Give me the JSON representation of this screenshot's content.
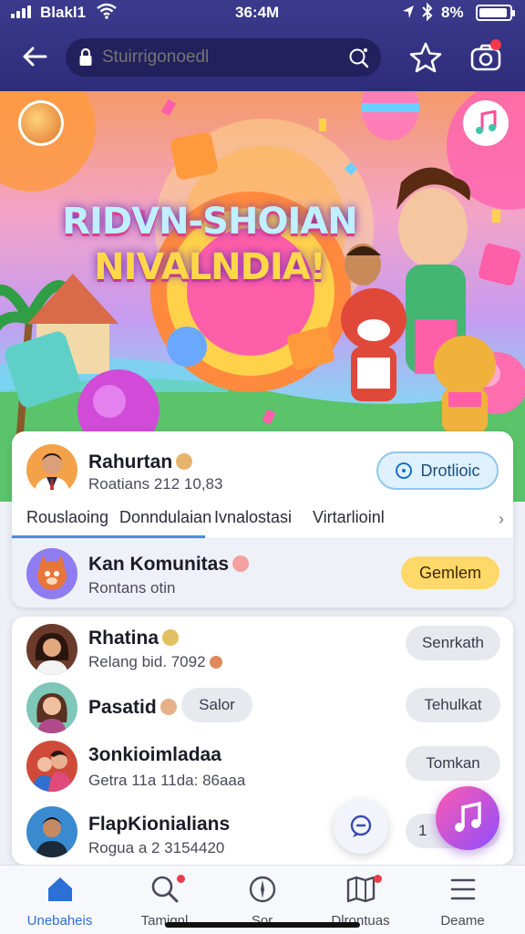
{
  "status_bar": {
    "carrier": "Blakl1",
    "time": "36:4M",
    "battery": "8%"
  },
  "browser": {
    "url_placeholder": "Stuirrigonoedl"
  },
  "hero": {
    "title_line1": "RIDVN-SHOIAN",
    "title_line2": "NIVALNDIA!"
  },
  "profile": {
    "name": "Rahurtan",
    "meta": "Roatians 212 10,83",
    "follow_label": "Drotlioic",
    "tabs": [
      "Rouslaoing",
      "Donndulaian",
      "Ivnalostasi",
      "Virtarlioinl"
    ]
  },
  "community": {
    "name": "Kan Komunitas",
    "sub": "Rontans otin",
    "join_label": "Gemlem"
  },
  "list": [
    {
      "name": "Rhatina",
      "sub": "Relang bid. 7092",
      "action": "Senrkath"
    },
    {
      "name": "Pasatid",
      "chip": "Salor",
      "action": "Tehulkat"
    },
    {
      "name": "3onkioimladaa",
      "sub": "Getra 11a 11da: 86aaa",
      "action": "Tomkan"
    },
    {
      "name": "FlapKionialians",
      "sub": "Rogua a 2 3154420",
      "action": "1"
    }
  ],
  "nav": [
    {
      "label": "Unebaheis"
    },
    {
      "label": "Tamiqnl"
    },
    {
      "label": "Sor"
    },
    {
      "label": "Dlrontuas"
    },
    {
      "label": "Deame"
    }
  ],
  "colors": {
    "topbar": "#2f2c7a",
    "accent": "#2c6fd6",
    "badge": "#f0394b",
    "join": "#ffd86a"
  }
}
